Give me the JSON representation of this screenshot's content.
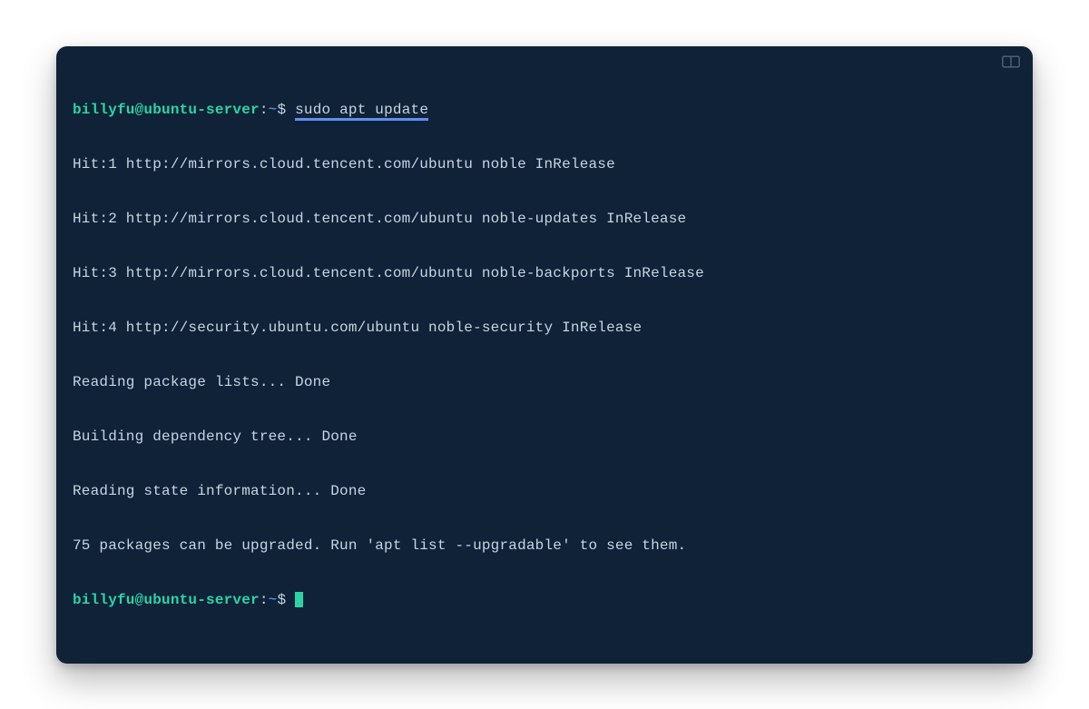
{
  "prompt": {
    "user_host": "billyfu@ubuntu-server",
    "colon": ":",
    "path": "~",
    "dollar": "$"
  },
  "command": "sudo apt update",
  "output": {
    "lines": [
      "Hit:1 http://mirrors.cloud.tencent.com/ubuntu noble InRelease",
      "Hit:2 http://mirrors.cloud.tencent.com/ubuntu noble-updates InRelease",
      "Hit:3 http://mirrors.cloud.tencent.com/ubuntu noble-backports InRelease",
      "Hit:4 http://security.ubuntu.com/ubuntu noble-security InRelease",
      "Reading package lists... Done",
      "Building dependency tree... Done",
      "Reading state information... Done",
      "75 packages can be upgraded. Run 'apt list --upgradable' to see them."
    ]
  },
  "colors": {
    "bg": "#0f2238",
    "prompt_green": "#2bd4a6",
    "prompt_blue": "#5fa8ff",
    "text": "#c7d5e0",
    "underline": "#5f8fef"
  }
}
